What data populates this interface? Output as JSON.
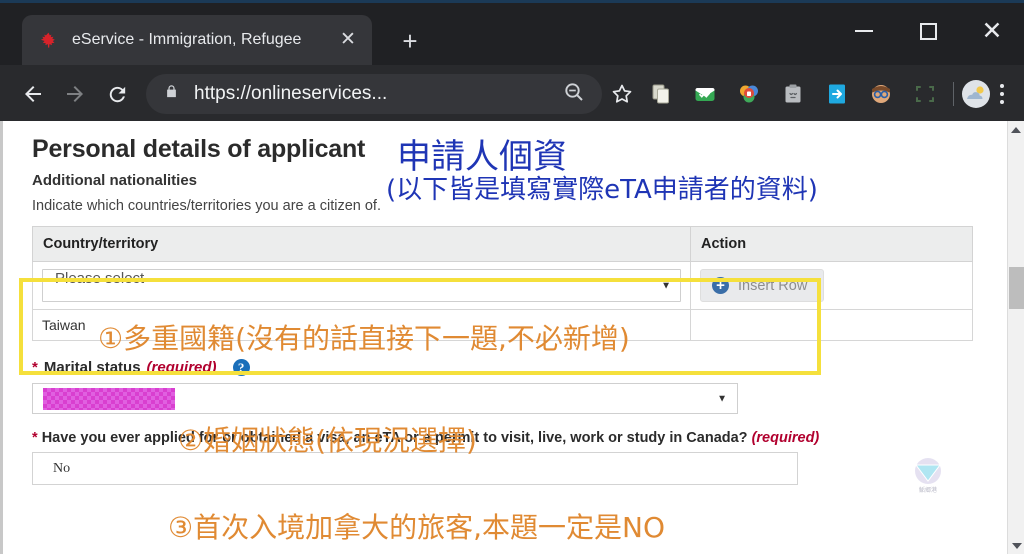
{
  "browser": {
    "tab": {
      "title": "eService - Immigration, Refugee",
      "favicon_name": "maple-leaf-favicon",
      "close_label": "✕"
    },
    "newtab_label": "+",
    "window_controls": {
      "minimize": "–",
      "maximize": "□",
      "close": "✕"
    },
    "toolbar": {
      "back": "←",
      "forward": "→",
      "reload": "⟳",
      "url": "https://onlineservices...",
      "lock_icon": "padlock-icon",
      "zoom_icon": "zoom-out-icon",
      "bookmark_icon": "star-icon",
      "extensions": [
        "copy-documents-extension-icon",
        "green-mail-extension-icon",
        "password-manager-extension-icon",
        "clipboard-extension-icon",
        "blue-export-extension-icon",
        "avatar-glasses-extension-icon",
        "screen-capture-extension-icon"
      ],
      "profile_icon": "weather-profile-avatar",
      "menu_icon": "three-dots-menu-icon"
    }
  },
  "page": {
    "title": "Personal details of applicant",
    "subheading": "Additional nationalities",
    "hint": "Indicate which countries/territories you are a citizen of.",
    "annotations_blue": {
      "line1": "申請人個資",
      "line2": "(以下皆是填寫實際eTA申請者的資料)",
      "color": "#1f35b5"
    },
    "annotations_orange": {
      "one": "①多重國籍(沒有的話直接下一題,不必新增)",
      "two": "②婚姻狀態(依現況選擇)",
      "three": "③首次入境加拿大的旅客,本題一定是NO",
      "color": "#e08a33"
    },
    "highlight_box_color": "#f5e03c",
    "nationalities_table": {
      "headers": [
        "Country/territory",
        "Action"
      ],
      "rows": [
        {
          "country_select_value": "Please select",
          "action_button": "Insert Row",
          "action_icon": "plus-circle-icon"
        },
        {
          "country": "Taiwan",
          "action_button": ""
        }
      ]
    },
    "marital_status": {
      "star": "*",
      "label": "Marital status",
      "required": "(required)",
      "help_icon": "question-mark-help-icon",
      "value": "",
      "redacted": true
    },
    "visa_question": {
      "star": "*",
      "label": "Have you ever applied for or obtained a visa, an eTA or a permit to visit, live, work or study in Canada?",
      "required": "(required)",
      "value": "No"
    },
    "watermark_name": "diamond-logo-watermark"
  }
}
